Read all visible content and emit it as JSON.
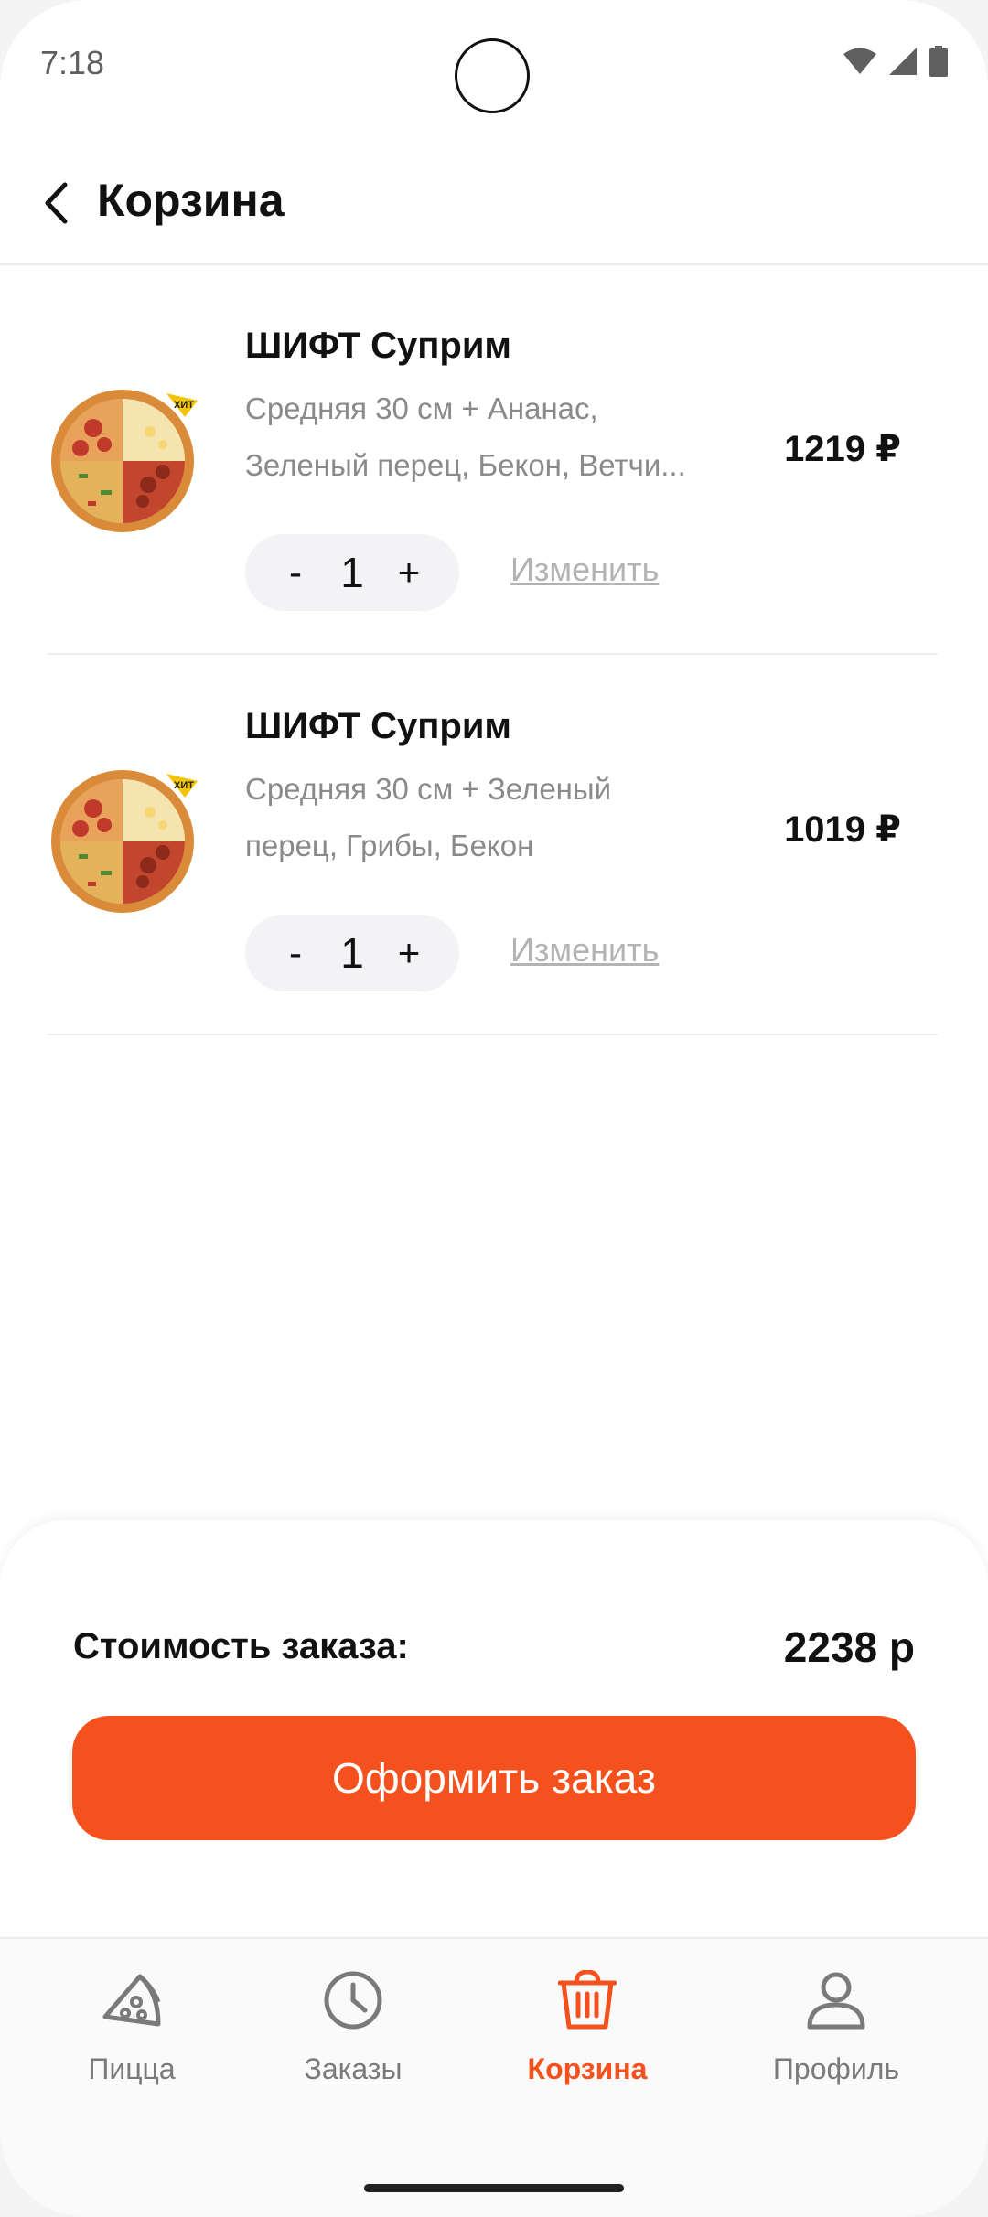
{
  "status_bar": {
    "time": "7:18"
  },
  "header": {
    "title": "Корзина"
  },
  "cart": {
    "items": [
      {
        "name": "ШИФТ Суприм",
        "desc_line1": "Средняя 30 см + Ананас,",
        "desc_line2": "Зеленый перец, Бекон, Ветчи...",
        "price": "1219 ₽",
        "quantity": "1",
        "minus": "-",
        "plus": "+",
        "edit": "Изменить",
        "badge": "ХИТ"
      },
      {
        "name": "ШИФТ Суприм",
        "desc_line1": "Средняя 30 см + Зеленый",
        "desc_line2": "перец, Грибы, Бекон",
        "price": "1019 ₽",
        "quantity": "1",
        "minus": "-",
        "plus": "+",
        "edit": "Изменить",
        "badge": "ХИТ"
      }
    ]
  },
  "summary": {
    "label": "Стоимость заказа:",
    "total": "2238 р",
    "checkout_label": "Оформить заказ"
  },
  "bottom_nav": {
    "items": [
      {
        "label": "Пицца",
        "icon": "pizza-slice-icon"
      },
      {
        "label": "Заказы",
        "icon": "clock-icon"
      },
      {
        "label": "Корзина",
        "icon": "basket-icon",
        "active": true
      },
      {
        "label": "Профиль",
        "icon": "user-icon"
      }
    ]
  },
  "colors": {
    "accent": "#f4511e",
    "text": "#111111",
    "muted": "#8a8a8a"
  }
}
